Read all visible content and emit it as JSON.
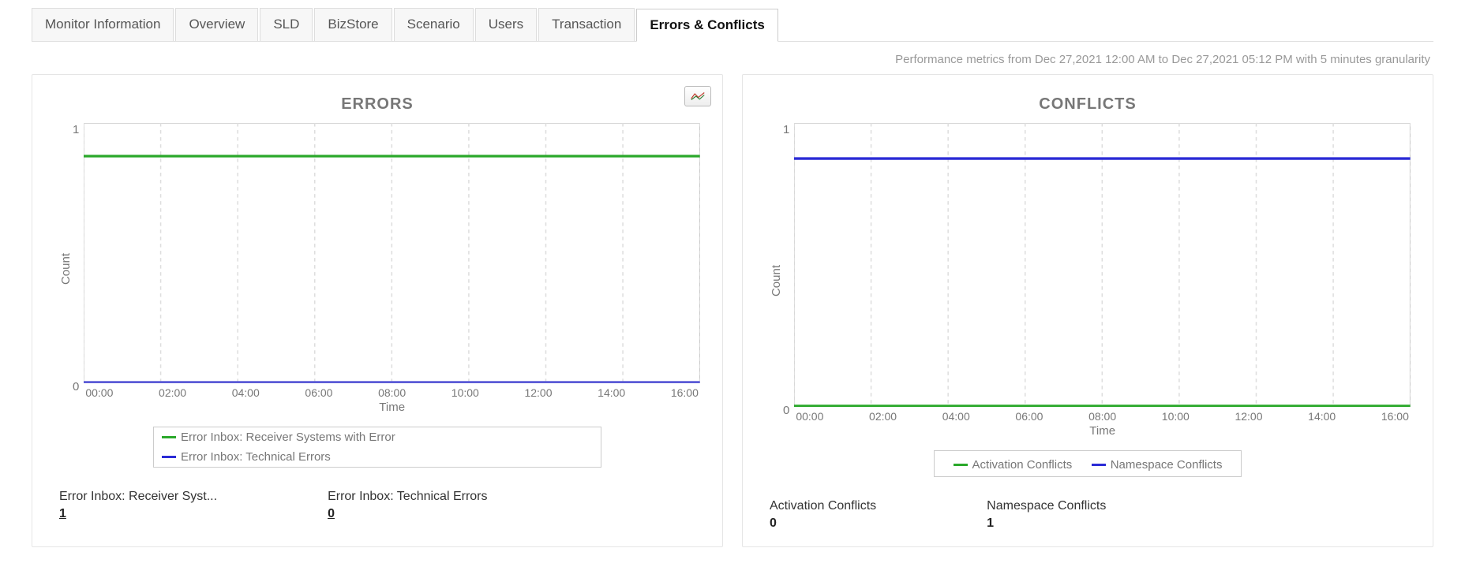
{
  "tabs": {
    "monitor_information": "Monitor Information",
    "overview": "Overview",
    "sld": "SLD",
    "bizstore": "BizStore",
    "scenario": "Scenario",
    "users": "Users",
    "transaction": "Transaction",
    "errors_conflicts": "Errors & Conflicts"
  },
  "subtitle": "Performance metrics from Dec 27,2021 12:00 AM to Dec 27,2021 05:12 PM with 5 minutes granularity",
  "errors_panel": {
    "title": "ERRORS",
    "ylabel": "Count",
    "xlabel": "Time",
    "yticks": [
      "1",
      "0"
    ],
    "xticks": [
      "00:00",
      "02:00",
      "04:00",
      "06:00",
      "08:00",
      "10:00",
      "12:00",
      "14:00",
      "16:00"
    ],
    "legend": {
      "a": "Error Inbox: Receiver Systems with Error",
      "b": "Error Inbox: Technical Errors"
    },
    "stat_a_label": "Error Inbox: Receiver Syst...",
    "stat_a_value": "1",
    "stat_b_label": "Error Inbox: Technical Errors",
    "stat_b_value": "0"
  },
  "conflicts_panel": {
    "title": "CONFLICTS",
    "ylabel": "Count",
    "xlabel": "Time",
    "yticks": [
      "1",
      "0"
    ],
    "xticks": [
      "00:00",
      "02:00",
      "04:00",
      "06:00",
      "08:00",
      "10:00",
      "12:00",
      "14:00",
      "16:00"
    ],
    "legend": {
      "a": "Activation Conflicts",
      "b": "Namespace Conflicts"
    },
    "stat_a_label": "Activation Conflicts",
    "stat_a_value": "0",
    "stat_b_label": "Namespace Conflicts",
    "stat_b_value": "1"
  },
  "colors": {
    "green": "#2aa82a",
    "blue": "#2b2bd6"
  },
  "chart_data": [
    {
      "type": "line",
      "title": "ERRORS",
      "xlabel": "Time",
      "ylabel": "Count",
      "categories": [
        "00:00",
        "02:00",
        "04:00",
        "06:00",
        "08:00",
        "10:00",
        "12:00",
        "14:00",
        "16:00"
      ],
      "ylim": [
        0,
        1
      ],
      "series": [
        {
          "name": "Error Inbox: Receiver Systems with Error",
          "color": "#2aa82a",
          "values": [
            1,
            1,
            1,
            1,
            1,
            1,
            1,
            1,
            1
          ]
        },
        {
          "name": "Error Inbox: Technical Errors",
          "color": "#2b2bd6",
          "values": [
            0,
            0,
            0,
            0,
            0,
            0,
            0,
            0,
            0
          ]
        }
      ]
    },
    {
      "type": "line",
      "title": "CONFLICTS",
      "xlabel": "Time",
      "ylabel": "Count",
      "categories": [
        "00:00",
        "02:00",
        "04:00",
        "06:00",
        "08:00",
        "10:00",
        "12:00",
        "14:00",
        "16:00"
      ],
      "ylim": [
        0,
        1
      ],
      "series": [
        {
          "name": "Activation Conflicts",
          "color": "#2aa82a",
          "values": [
            0,
            0,
            0,
            0,
            0,
            0,
            0,
            0,
            0
          ]
        },
        {
          "name": "Namespace Conflicts",
          "color": "#2b2bd6",
          "values": [
            1,
            1,
            1,
            1,
            1,
            1,
            1,
            1,
            1
          ]
        }
      ]
    }
  ]
}
